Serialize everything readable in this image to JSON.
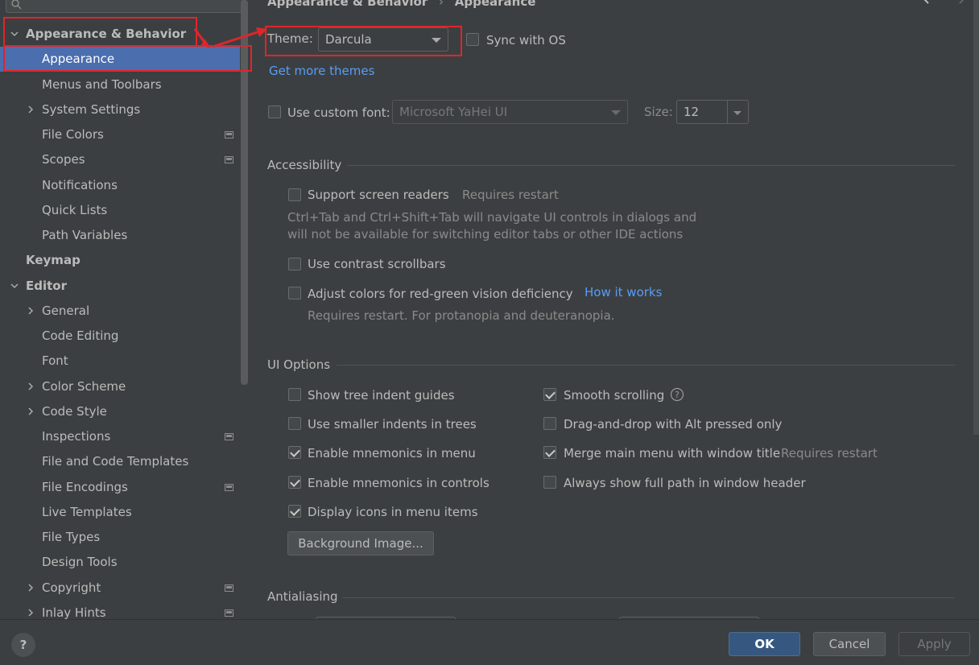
{
  "sidebar": {
    "items": [
      {
        "label": "Appearance & Behavior"
      },
      {
        "label": "Appearance"
      },
      {
        "label": "Menus and Toolbars"
      },
      {
        "label": "System Settings"
      },
      {
        "label": "File Colors"
      },
      {
        "label": "Scopes"
      },
      {
        "label": "Notifications"
      },
      {
        "label": "Quick Lists"
      },
      {
        "label": "Path Variables"
      },
      {
        "label": "Keymap"
      },
      {
        "label": "Editor"
      },
      {
        "label": "General"
      },
      {
        "label": "Code Editing"
      },
      {
        "label": "Font"
      },
      {
        "label": "Color Scheme"
      },
      {
        "label": "Code Style"
      },
      {
        "label": "Inspections"
      },
      {
        "label": "File and Code Templates"
      },
      {
        "label": "File Encodings"
      },
      {
        "label": "Live Templates"
      },
      {
        "label": "File Types"
      },
      {
        "label": "Design Tools"
      },
      {
        "label": "Copyright"
      },
      {
        "label": "Inlay Hints"
      }
    ]
  },
  "breadcrumb": {
    "parent": "Appearance & Behavior",
    "separator": "›",
    "current": "Appearance"
  },
  "theme": {
    "label": "Theme:",
    "value": "Darcula",
    "sync_label": "Sync with OS",
    "get_more": "Get more themes"
  },
  "font": {
    "custom_label": "Use custom font:",
    "font_value": "Microsoft YaHei UI",
    "size_label": "Size:",
    "size_value": "12"
  },
  "accessibility": {
    "title": "Accessibility",
    "screen_readers": "Support screen readers",
    "requires_restart": "Requires restart",
    "desc_line1": "Ctrl+Tab and Ctrl+Shift+Tab will navigate UI controls in dialogs and",
    "desc_line2": "will not be available for switching editor tabs or other IDE actions",
    "contrast_scrollbars": "Use contrast scrollbars",
    "color_deficiency": "Adjust colors for red-green vision deficiency",
    "how_it_works": "How it works",
    "deficiency_note": "Requires restart. For protanopia and deuteranopia."
  },
  "ui_options": {
    "title": "UI Options",
    "left": [
      {
        "label": "Show tree indent guides",
        "checked": false
      },
      {
        "label": "Use smaller indents in trees",
        "checked": false
      },
      {
        "label": "Enable mnemonics in menu",
        "checked": true
      },
      {
        "label": "Enable mnemonics in controls",
        "checked": true
      },
      {
        "label": "Display icons in menu items",
        "checked": true
      }
    ],
    "right": [
      {
        "label": "Smooth scrolling",
        "checked": true
      },
      {
        "label": "Drag-and-drop with Alt pressed only",
        "checked": false
      },
      {
        "label": "Merge main menu with window title",
        "checked": true
      },
      {
        "label": "Always show full path in window header",
        "checked": false
      }
    ],
    "merge_note": "Requires restart",
    "background_image": "Background Image..."
  },
  "antialiasing": {
    "title": "Antialiasing"
  },
  "footer": {
    "help": "?",
    "ok": "OK",
    "cancel": "Cancel",
    "apply": "Apply"
  },
  "colors": {
    "selection": "#4b6eaf",
    "link": "#589df6",
    "annotation": "#e0252b",
    "ok_button": "#365880"
  }
}
